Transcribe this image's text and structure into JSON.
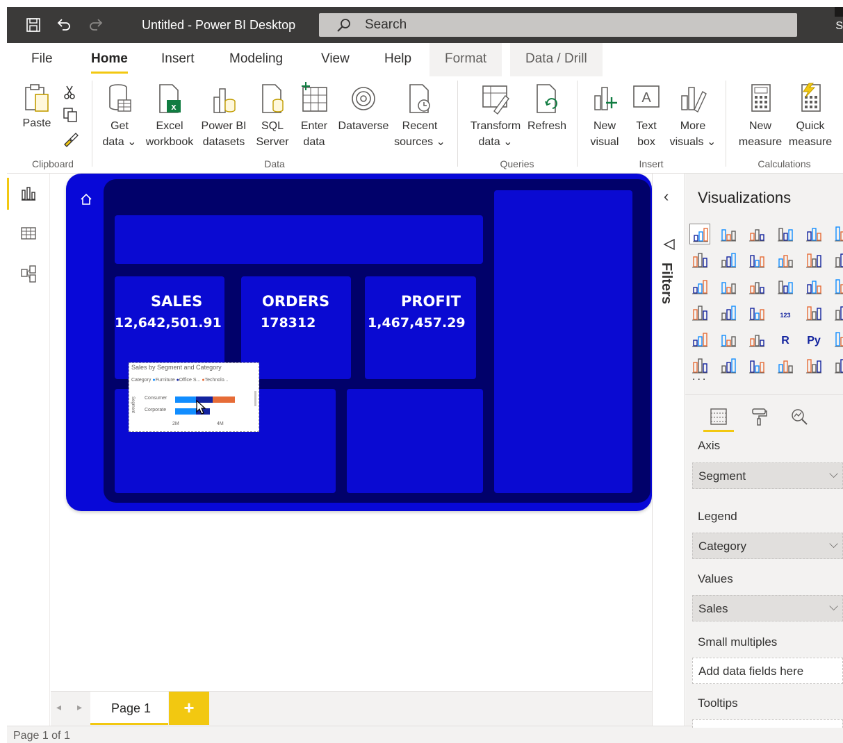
{
  "titlebar": {
    "title": "Untitled - Power BI Desktop",
    "search_placeholder": "Search",
    "right_mark": "S"
  },
  "menu": {
    "tabs": [
      "File",
      "Home",
      "Insert",
      "Modeling",
      "View",
      "Help"
    ],
    "context_tabs": [
      "Format",
      "Data / Drill"
    ],
    "active": "Home"
  },
  "ribbon": {
    "clipboard": {
      "paste": "Paste",
      "group": "Clipboard"
    },
    "data": {
      "get_data_1": "Get",
      "get_data_2": "data ⌄",
      "excel_1": "Excel",
      "excel_2": "workbook",
      "pbi_1": "Power BI",
      "pbi_2": "datasets",
      "sql_1": "SQL",
      "sql_2": "Server",
      "enter_1": "Enter",
      "enter_2": "data",
      "dataverse": "Dataverse",
      "recent_1": "Recent",
      "recent_2": "sources ⌄",
      "group": "Data"
    },
    "queries": {
      "transform_1": "Transform",
      "transform_2": "data ⌄",
      "refresh": "Refresh",
      "group": "Queries"
    },
    "insert": {
      "newvisual_1": "New",
      "newvisual_2": "visual",
      "textbox_1": "Text",
      "textbox_2": "box",
      "more_1": "More",
      "more_2": "visuals ⌄",
      "group": "Insert"
    },
    "calculations": {
      "newmeasure_1": "New",
      "newmeasure_2": "measure",
      "quick_1": "Quick",
      "quick_2": "measure",
      "group": "Calculations"
    }
  },
  "report": {
    "kpis": [
      {
        "title": "SALES",
        "value": "12,642,501.91"
      },
      {
        "title": "ORDERS",
        "value": "178312"
      },
      {
        "title": "PROFIT",
        "value": "1,467,457.29"
      }
    ],
    "minichart": {
      "title": "Sales by Segment and Category",
      "legend_label": "Category",
      "legend": [
        "Furniture",
        "Office S...",
        "Technolo..."
      ],
      "rows": [
        "Consumer",
        "Corporate"
      ],
      "ticks": [
        "2M",
        "4M"
      ],
      "axis_label": "Segment",
      "colors": [
        "#118dff",
        "#12239e",
        "#e66c37"
      ]
    }
  },
  "pages": {
    "tab": "Page 1",
    "add": "+",
    "status": "Page 1 of 1"
  },
  "filters": {
    "label": "Filters"
  },
  "viz": {
    "title": "Visualizations",
    "more": "...",
    "wells": {
      "axis_label": "Axis",
      "axis_value": "Segment",
      "legend_label": "Legend",
      "legend_value": "Category",
      "values_label": "Values",
      "values_value": "Sales",
      "sm_label": "Small multiples",
      "sm_placeholder": "Add data fields here",
      "tooltips_label": "Tooltips"
    }
  },
  "colors": {
    "accent": "#f2c811",
    "report_bg": "#0808d8",
    "report_inner": "#01016a",
    "titlebar": "#3b3a39"
  }
}
